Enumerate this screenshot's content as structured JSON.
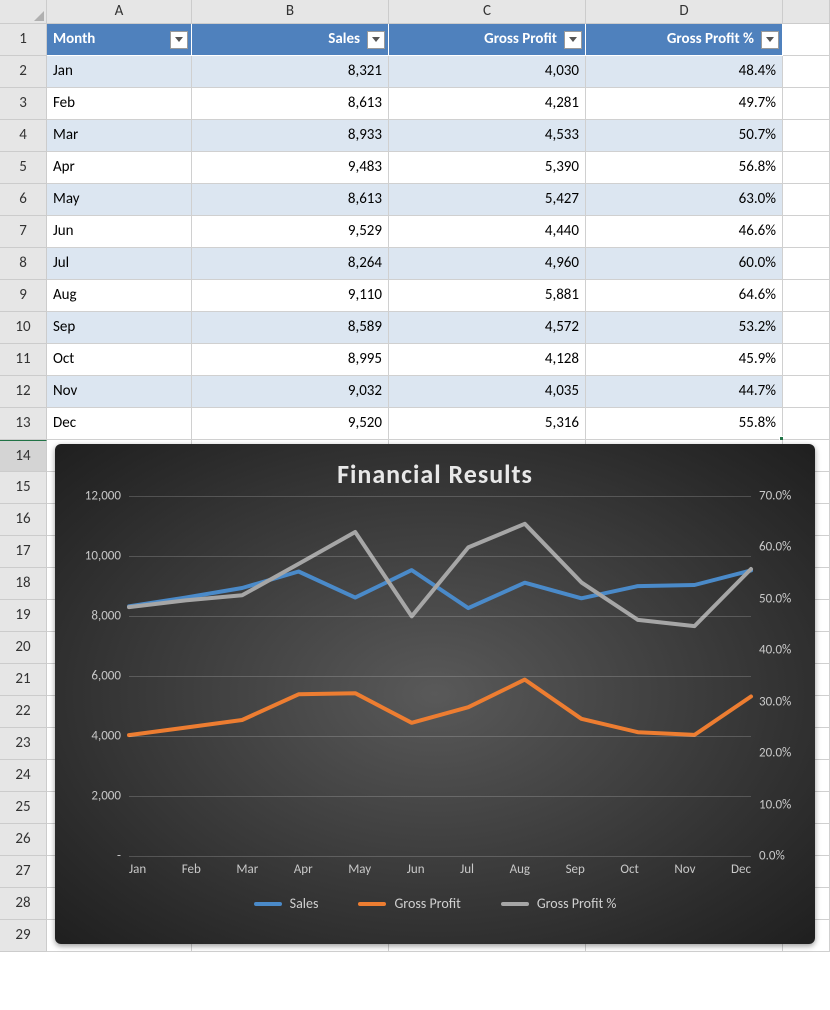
{
  "columns": [
    "A",
    "B",
    "C",
    "D"
  ],
  "header": {
    "month": "Month",
    "sales": "Sales",
    "gp": "Gross Profit",
    "gpp": "Gross Profit %"
  },
  "rows": [
    {
      "m": "Jan",
      "s": "8,321",
      "g": "4,030",
      "p": "48.4%"
    },
    {
      "m": "Feb",
      "s": "8,613",
      "g": "4,281",
      "p": "49.7%"
    },
    {
      "m": "Mar",
      "s": "8,933",
      "g": "4,533",
      "p": "50.7%"
    },
    {
      "m": "Apr",
      "s": "9,483",
      "g": "5,390",
      "p": "56.8%"
    },
    {
      "m": "May",
      "s": "8,613",
      "g": "5,427",
      "p": "63.0%"
    },
    {
      "m": "Jun",
      "s": "9,529",
      "g": "4,440",
      "p": "46.6%"
    },
    {
      "m": "Jul",
      "s": "8,264",
      "g": "4,960",
      "p": "60.0%"
    },
    {
      "m": "Aug",
      "s": "9,110",
      "g": "5,881",
      "p": "64.6%"
    },
    {
      "m": "Sep",
      "s": "8,589",
      "g": "4,572",
      "p": "53.2%"
    },
    {
      "m": "Oct",
      "s": "8,995",
      "g": "4,128",
      "p": "45.9%"
    },
    {
      "m": "Nov",
      "s": "9,032",
      "g": "4,035",
      "p": "44.7%"
    },
    {
      "m": "Dec",
      "s": "9,520",
      "g": "5,316",
      "p": "55.8%"
    }
  ],
  "chart_data": {
    "type": "line",
    "title": "Financial Results",
    "categories": [
      "Jan",
      "Feb",
      "Mar",
      "Apr",
      "May",
      "Jun",
      "Jul",
      "Aug",
      "Sep",
      "Oct",
      "Nov",
      "Dec"
    ],
    "y1": {
      "label": "",
      "ticks": [
        "-",
        "2,000",
        "4,000",
        "6,000",
        "8,000",
        "10,000",
        "12,000"
      ],
      "min": 0,
      "max": 12000
    },
    "y2": {
      "label": "",
      "ticks": [
        "0.0%",
        "10.0%",
        "20.0%",
        "30.0%",
        "40.0%",
        "50.0%",
        "60.0%",
        "70.0%"
      ],
      "min": 0,
      "max": 70
    },
    "series": [
      {
        "name": "Sales",
        "axis": "y1",
        "color": "#4a8ac9",
        "values": [
          8321,
          8613,
          8933,
          9483,
          8613,
          9529,
          8264,
          9110,
          8589,
          8995,
          9032,
          9520
        ]
      },
      {
        "name": "Gross Profit",
        "axis": "y1",
        "color": "#ed7d31",
        "values": [
          4030,
          4281,
          4533,
          5390,
          5427,
          4440,
          4960,
          5881,
          4572,
          4128,
          4035,
          5316
        ]
      },
      {
        "name": "Gross Profit %",
        "axis": "y2",
        "color": "#a6a6a6",
        "values": [
          48.4,
          49.7,
          50.7,
          56.8,
          63.0,
          46.6,
          60.0,
          64.6,
          53.2,
          45.9,
          44.7,
          55.8
        ]
      }
    ]
  },
  "extra_rows": 16
}
